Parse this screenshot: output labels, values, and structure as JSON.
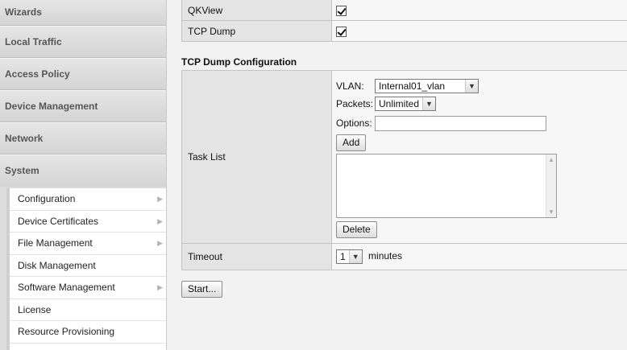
{
  "sidebar": {
    "sections": [
      "Wizards",
      "Local Traffic",
      "Access Policy",
      "Device Management",
      "Network",
      "System"
    ],
    "system_submenu": [
      {
        "label": "Configuration",
        "has_submenu": true
      },
      {
        "label": "Device Certificates",
        "has_submenu": true
      },
      {
        "label": "File Management",
        "has_submenu": true
      },
      {
        "label": "Disk Management",
        "has_submenu": false
      },
      {
        "label": "Software Management",
        "has_submenu": true
      },
      {
        "label": "License",
        "has_submenu": false
      },
      {
        "label": "Resource Provisioning",
        "has_submenu": false
      }
    ]
  },
  "main": {
    "qkview": {
      "label": "QKView",
      "checked": true
    },
    "tcpdump": {
      "label": "TCP Dump",
      "checked": true
    },
    "section_title": "TCP Dump Configuration",
    "task_list": {
      "label": "Task List",
      "vlan_label": "VLAN:",
      "vlan_value": "Internal01_vlan",
      "packets_label": "Packets:",
      "packets_value": "Unlimited",
      "options_label": "Options:",
      "options_value": "",
      "add_label": "Add",
      "delete_label": "Delete"
    },
    "timeout": {
      "label": "Timeout",
      "value": "1",
      "unit": "minutes"
    },
    "start_label": "Start..."
  },
  "icons": {
    "submenu_arrow": "chevron-right-icon",
    "dropdown_arrow": "chevron-down-icon",
    "check": "check-icon"
  }
}
